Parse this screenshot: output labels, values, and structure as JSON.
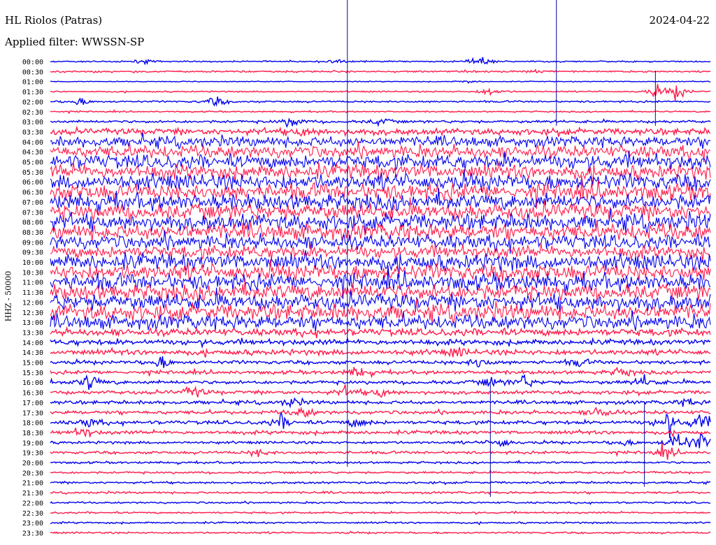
{
  "header": {
    "station": "HL Riolos (Patras)",
    "filter": "Applied filter: WWSSN-SP",
    "date": "2024-04-22"
  },
  "channel_label": "HHZ - 50000",
  "colors": {
    "trace_a": "#0000ee",
    "trace_b": "#ff1a4a",
    "spike": "#0000aa"
  },
  "chart_data": {
    "type": "line",
    "title": "HL Riolos (Patras)",
    "subtitle": "Applied filter: WWSSN-SP",
    "ylabel": "HHZ - 50000",
    "grid": false,
    "rows": [
      "00:00",
      "00:30",
      "01:00",
      "01:30",
      "02:00",
      "02:30",
      "03:00",
      "03:30",
      "04:00",
      "04:30",
      "05:00",
      "05:30",
      "06:00",
      "06:30",
      "07:00",
      "07:30",
      "08:00",
      "08:30",
      "09:00",
      "09:30",
      "10:00",
      "10:30",
      "11:00",
      "11:30",
      "12:00",
      "12:30",
      "13:00",
      "13:30",
      "14:00",
      "14:30",
      "15:00",
      "15:30",
      "16:00",
      "16:30",
      "17:00",
      "17:30",
      "18:00",
      "18:30",
      "19:00",
      "19:30",
      "20:00",
      "20:30",
      "21:00",
      "21:30",
      "22:00",
      "22:30",
      "23:00",
      "23:30"
    ],
    "row_duration_minutes": 30,
    "noise_level": [
      0.8,
      1.0,
      0.5,
      0.8,
      1.0,
      0.8,
      1.5,
      3.5,
      6,
      7,
      8,
      8,
      9,
      9,
      9,
      9,
      9,
      9,
      8,
      7,
      9,
      9,
      9,
      9,
      9,
      9,
      8,
      4,
      3,
      3,
      2,
      2,
      2,
      2,
      2,
      2,
      2,
      2,
      1.5,
      1.5,
      1.2,
      1.2,
      1.2,
      1.2,
      1,
      1,
      1,
      1
    ],
    "events": [
      {
        "row": 0,
        "minute": 4.2,
        "amp": 3
      },
      {
        "row": 0,
        "minute": 13.0,
        "amp": 3
      },
      {
        "row": 0,
        "minute": 19.5,
        "amp": 7
      },
      {
        "row": 1,
        "minute": 22.0,
        "amp": 2
      },
      {
        "row": 2,
        "minute": 19.0,
        "amp": 2
      },
      {
        "row": 3,
        "minute": 20.0,
        "amp": 6
      },
      {
        "row": 3,
        "minute": 28.5,
        "amp": 10
      },
      {
        "row": 3,
        "minute": 27.5,
        "amp": 6
      },
      {
        "row": 4,
        "minute": 1.3,
        "amp": 6
      },
      {
        "row": 4,
        "minute": 7.5,
        "amp": 7
      },
      {
        "row": 6,
        "minute": 11.0,
        "amp": 9
      },
      {
        "row": 6,
        "minute": 15.0,
        "amp": 5
      },
      {
        "row": 7,
        "minute": 11.5,
        "amp": 5
      },
      {
        "row": 29,
        "minute": 18.5,
        "amp": 6
      },
      {
        "row": 30,
        "minute": 5.0,
        "amp": 9
      },
      {
        "row": 30,
        "minute": 19.5,
        "amp": 8
      },
      {
        "row": 30,
        "minute": 24.0,
        "amp": 5
      },
      {
        "row": 31,
        "minute": 14.0,
        "amp": 8
      },
      {
        "row": 31,
        "minute": 26.0,
        "amp": 7
      },
      {
        "row": 32,
        "minute": 1.8,
        "amp": 12
      },
      {
        "row": 32,
        "minute": 20.0,
        "amp": 7
      },
      {
        "row": 32,
        "minute": 21.5,
        "amp": 9
      },
      {
        "row": 32,
        "minute": 27.0,
        "amp": 7
      },
      {
        "row": 33,
        "minute": 6.5,
        "amp": 9
      },
      {
        "row": 33,
        "minute": 13.5,
        "amp": 7
      },
      {
        "row": 33,
        "minute": 15.0,
        "amp": 7
      },
      {
        "row": 34,
        "minute": 11.0,
        "amp": 6
      },
      {
        "row": 34,
        "minute": 29.0,
        "amp": 5
      },
      {
        "row": 35,
        "minute": 11.5,
        "amp": 8
      },
      {
        "row": 35,
        "minute": 25.0,
        "amp": 10
      },
      {
        "row": 36,
        "minute": 1.8,
        "amp": 6
      },
      {
        "row": 36,
        "minute": 10.5,
        "amp": 9
      },
      {
        "row": 36,
        "minute": 14.0,
        "amp": 8
      },
      {
        "row": 36,
        "minute": 28.0,
        "amp": 14
      },
      {
        "row": 36,
        "minute": 29.5,
        "amp": 12
      },
      {
        "row": 37,
        "minute": 1.5,
        "amp": 8
      },
      {
        "row": 38,
        "minute": 20.5,
        "amp": 8
      },
      {
        "row": 38,
        "minute": 26.0,
        "amp": 6
      },
      {
        "row": 38,
        "minute": 28.5,
        "amp": 16
      },
      {
        "row": 38,
        "minute": 29.5,
        "amp": 12
      },
      {
        "row": 39,
        "minute": 9.5,
        "amp": 6
      },
      {
        "row": 39,
        "minute": 28.0,
        "amp": 8
      }
    ],
    "spikes": [
      {
        "row": 0,
        "minute": 13.5,
        "to_row": 40
      },
      {
        "row": 0,
        "minute": 23.0,
        "to_row": 6
      },
      {
        "row": 3,
        "minute": 27.5,
        "to_row": 6
      },
      {
        "row": 34,
        "minute": 20.0,
        "to_row": 43
      },
      {
        "row": 36,
        "minute": 27.0,
        "to_row": 42
      }
    ]
  }
}
